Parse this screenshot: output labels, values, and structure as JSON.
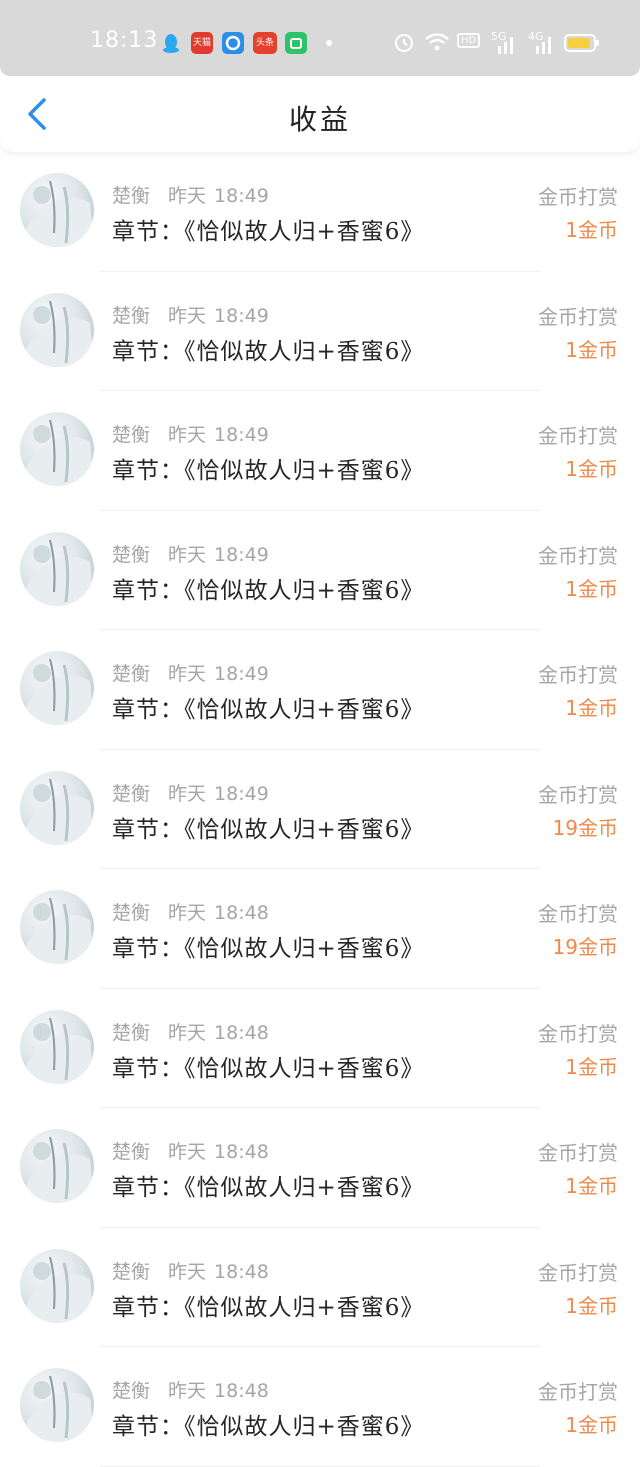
{
  "status_bar": {
    "time": "18:13",
    "app_icons": [
      {
        "name": "qq-icon",
        "color": "#2aa9f0",
        "label": ""
      },
      {
        "name": "tmall-icon",
        "color": "#e23b2e",
        "label": "天猫"
      },
      {
        "name": "browser-icon",
        "color": "#2b8fe8",
        "label": ""
      },
      {
        "name": "toutiao-icon",
        "color": "#e6402e",
        "label": "头条"
      },
      {
        "name": "store-icon",
        "color": "#2dc36a",
        "label": ""
      }
    ],
    "network_labels": {
      "hd": "HD",
      "sim1": "5G",
      "sim2": "4G"
    },
    "battery_color": "#f5cf3d"
  },
  "nav": {
    "back_icon": "chevron-left-icon",
    "title": "收益",
    "accent": "#2f8fe8"
  },
  "rows": [
    {
      "user": "楚衡",
      "day": "昨天",
      "time": "18:49",
      "chapter": "章节：《恰似故人归+香蜜6》",
      "type": "金币打赏",
      "amount": "1金币"
    },
    {
      "user": "楚衡",
      "day": "昨天",
      "time": "18:49",
      "chapter": "章节：《恰似故人归+香蜜6》",
      "type": "金币打赏",
      "amount": "1金币"
    },
    {
      "user": "楚衡",
      "day": "昨天",
      "time": "18:49",
      "chapter": "章节：《恰似故人归+香蜜6》",
      "type": "金币打赏",
      "amount": "1金币"
    },
    {
      "user": "楚衡",
      "day": "昨天",
      "time": "18:49",
      "chapter": "章节：《恰似故人归+香蜜6》",
      "type": "金币打赏",
      "amount": "1金币"
    },
    {
      "user": "楚衡",
      "day": "昨天",
      "time": "18:49",
      "chapter": "章节：《恰似故人归+香蜜6》",
      "type": "金币打赏",
      "amount": "1金币"
    },
    {
      "user": "楚衡",
      "day": "昨天",
      "time": "18:49",
      "chapter": "章节：《恰似故人归+香蜜6》",
      "type": "金币打赏",
      "amount": "19金币"
    },
    {
      "user": "楚衡",
      "day": "昨天",
      "time": "18:48",
      "chapter": "章节：《恰似故人归+香蜜6》",
      "type": "金币打赏",
      "amount": "19金币"
    },
    {
      "user": "楚衡",
      "day": "昨天",
      "time": "18:48",
      "chapter": "章节：《恰似故人归+香蜜6》",
      "type": "金币打赏",
      "amount": "1金币"
    },
    {
      "user": "楚衡",
      "day": "昨天",
      "time": "18:48",
      "chapter": "章节：《恰似故人归+香蜜6》",
      "type": "金币打赏",
      "amount": "1金币"
    },
    {
      "user": "楚衡",
      "day": "昨天",
      "time": "18:48",
      "chapter": "章节：《恰似故人归+香蜜6》",
      "type": "金币打赏",
      "amount": "1金币"
    },
    {
      "user": "楚衡",
      "day": "昨天",
      "time": "18:48",
      "chapter": "章节：《恰似故人归+香蜜6》",
      "type": "金币打赏",
      "amount": "1金币"
    }
  ]
}
